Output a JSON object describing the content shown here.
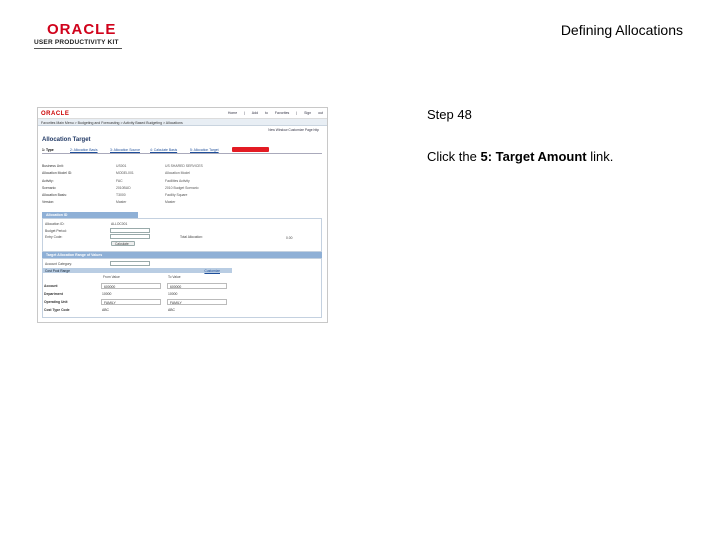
{
  "header": {
    "logo_word": "ORACLE",
    "logo_sub": "USER PRODUCTIVITY KIT",
    "doc_title": "Defining Allocations"
  },
  "instructions": {
    "step": "Step 48",
    "click_prefix": "Click the ",
    "link_name": "5: Target Amount",
    "click_suffix": " link."
  },
  "screenshot": {
    "logo": "ORACLE",
    "top_links": "Home | Add to Favorites | Sign out",
    "nav": "Favorites  Main Menu  > Budgeting and Forecasting  > Activity Based Budgeting  > Allocations",
    "util": "New Window  Customize Page  http",
    "page_title": "Allocation Target",
    "tabs": [
      {
        "label": "1: Type",
        "active": true
      },
      {
        "label": "2: Allocation Basis",
        "active": false
      },
      {
        "label": "3: Allocation Source",
        "active": false
      },
      {
        "label": "4: Calculate Basis",
        "active": false
      },
      {
        "label": "5: Allocation Target",
        "active": false
      }
    ],
    "fields": [
      {
        "label": "Business Unit:",
        "v1": "US001",
        "v2": "US SHARED SERVICES"
      },
      {
        "label": "Allocation Model ID:",
        "v1": "MODEL001",
        "v2": "Allocation Model"
      },
      {
        "label": "Activity:",
        "v1": "FAC",
        "v2": "Facilities Activity"
      },
      {
        "label": "Scenario:",
        "v1": "2010BUD",
        "v2": "2010 Budget Scenario"
      },
      {
        "label": "Allocation Basis:",
        "v1": "T3000",
        "v2": "Facility Square"
      },
      {
        "label": "Version:",
        "v1": "Master",
        "v2": "Master"
      }
    ],
    "alloc_box_title": "Allocation ID",
    "alloc_labels": [
      "Allocation ID:",
      "Budget Period:",
      "Entry Code:"
    ],
    "alloc_value": "ALLOC001",
    "total_label": "Total Allocation:",
    "total_value": "0.00",
    "button_label": "Calculate",
    "range_bar": "Target Allocation Range of Values",
    "account_category_label": "Account Category:",
    "grid_title": "Cost Pool Range",
    "grid_link": "Customize",
    "col_headers": [
      "From Value",
      "To Value"
    ],
    "grid_rows": [
      {
        "label": "Account",
        "from": "600000",
        "to": "600000",
        "boxed": true
      },
      {
        "label": "Department",
        "from": "10000",
        "to": "10000",
        "boxed": false
      },
      {
        "label": "Operating Unit",
        "from": "FAMILY",
        "to": "FAMILY",
        "boxed": true
      },
      {
        "label": "Cost Type Code",
        "from": "ABC",
        "to": "ABC",
        "boxed": false
      }
    ]
  }
}
